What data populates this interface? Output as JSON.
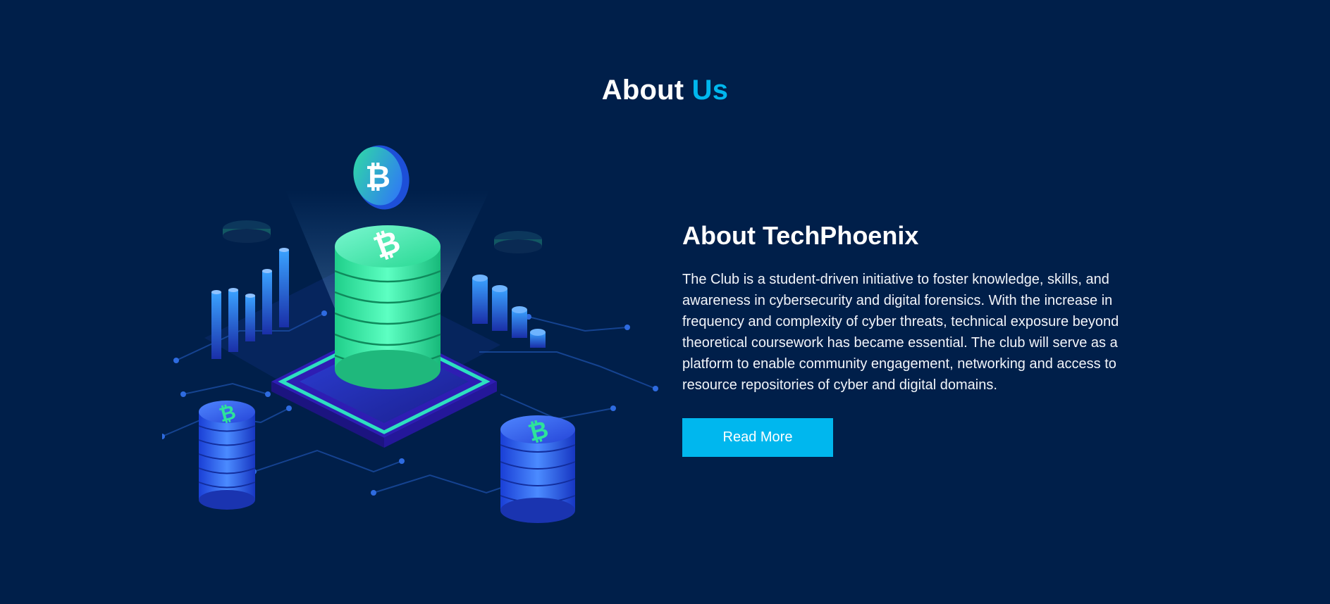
{
  "section": {
    "title_main": "About",
    "title_accent": "Us"
  },
  "about": {
    "heading": "About TechPhoenix",
    "description": "The Club is a student-driven initiative to foster knowledge, skills, and awareness in cybersecurity and digital forensics. With the increase in frequency and complexity of cyber threats, technical exposure beyond theoretical coursework has became essential. The club will serve as a platform to enable community engagement, networking and access to resource repositories of cyber and digital domains.",
    "button_label": "Read More"
  },
  "colors": {
    "background": "#001f4a",
    "accent": "#00b7ee",
    "coin_green": "#2de39a",
    "coin_blue": "#2f6dff"
  },
  "illustration": {
    "subject": "isometric crypto-coin stacks on circuit board",
    "icons": [
      "bitcoin-coin-icon",
      "coin-stack-icon",
      "bar-chart-icon",
      "circuit-board-icon"
    ]
  }
}
